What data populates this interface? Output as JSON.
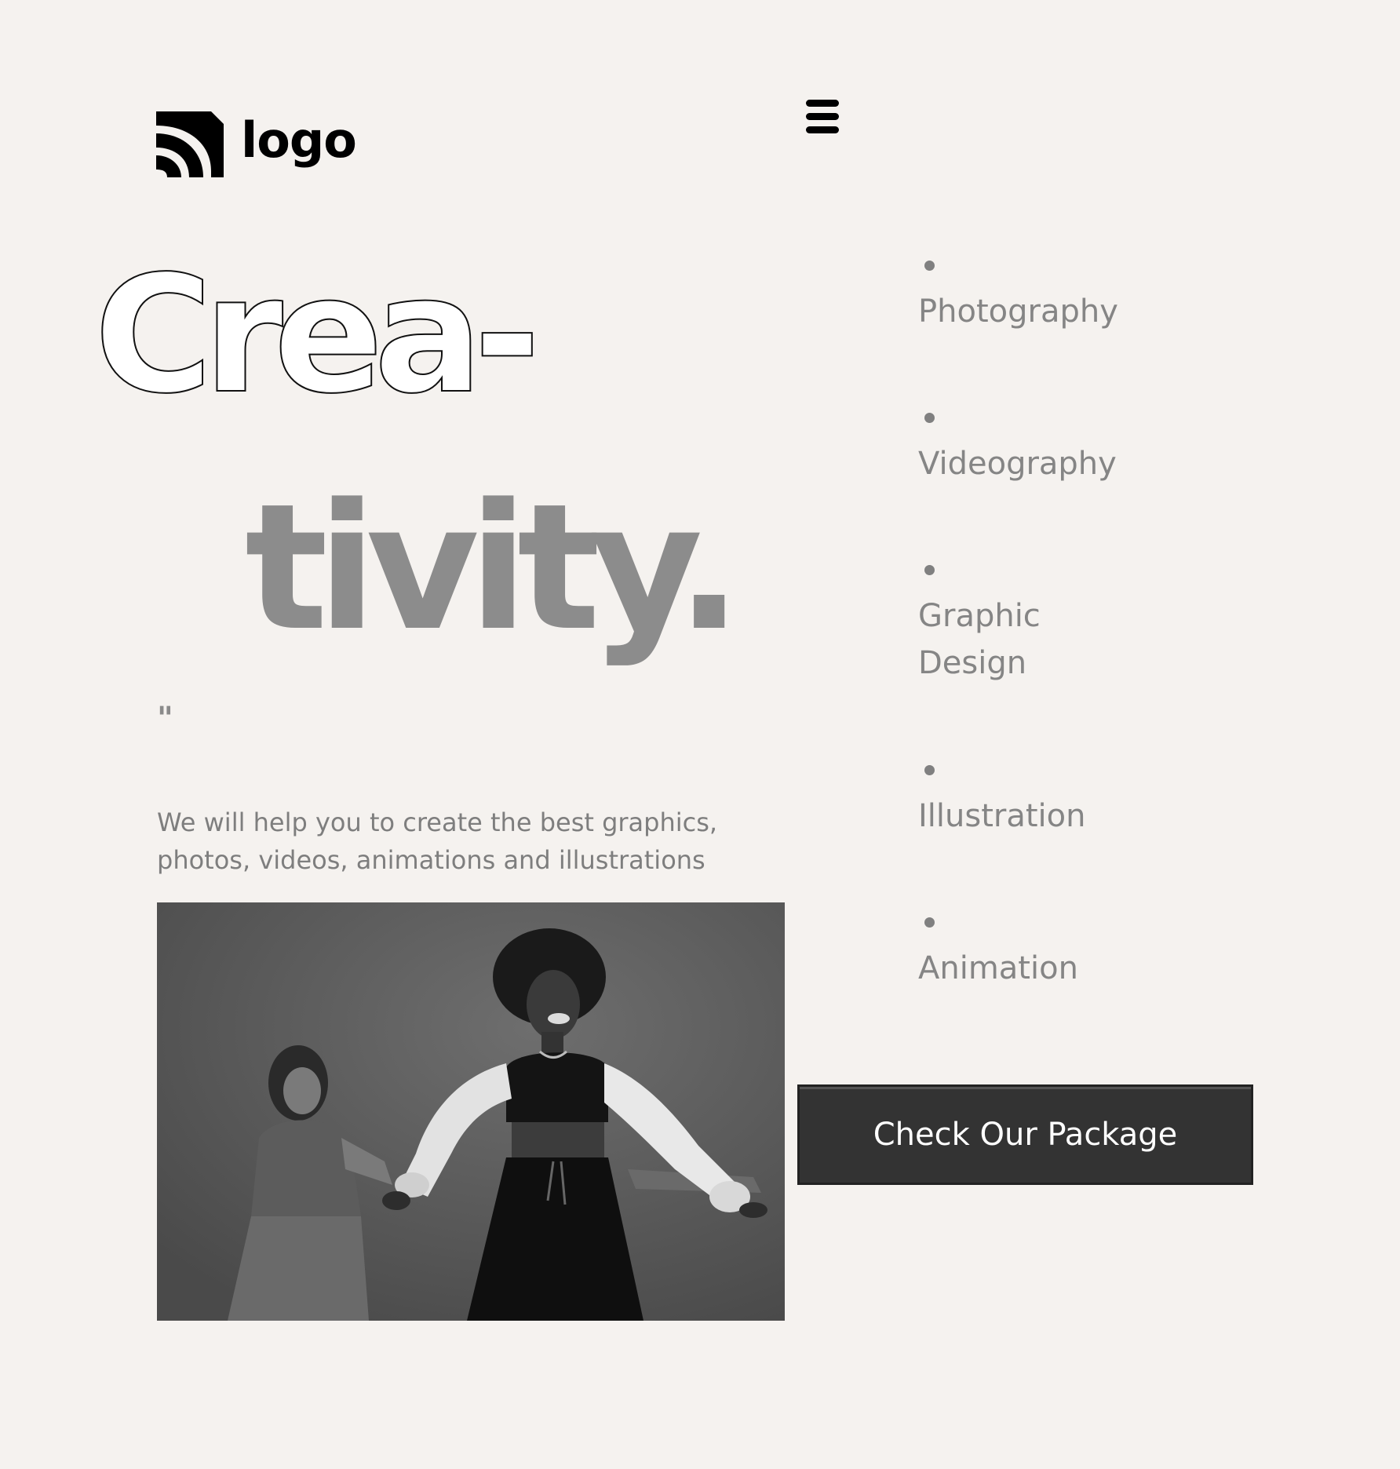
{
  "header": {
    "logo_text": "logo",
    "menu_icon": "hamburger-menu-icon"
  },
  "hero": {
    "headline_line1": "Crea-",
    "headline_line2": "tivity.",
    "quote_mark": "\"",
    "description": "We will help you to create the best graphics, photos, videos, animations and illustrations"
  },
  "services": {
    "items": [
      {
        "label": "Photography"
      },
      {
        "label": "Videography"
      },
      {
        "label": "Graphic Design"
      },
      {
        "label": "Illustration"
      },
      {
        "label": "Animation"
      }
    ]
  },
  "cta": {
    "label": "Check Our Package"
  },
  "colors": {
    "background": "#f5f2ef",
    "muted_text": "#858585",
    "headline_gray": "#8c8c8c",
    "button_bg": "#333333",
    "button_text": "#ffffff"
  }
}
